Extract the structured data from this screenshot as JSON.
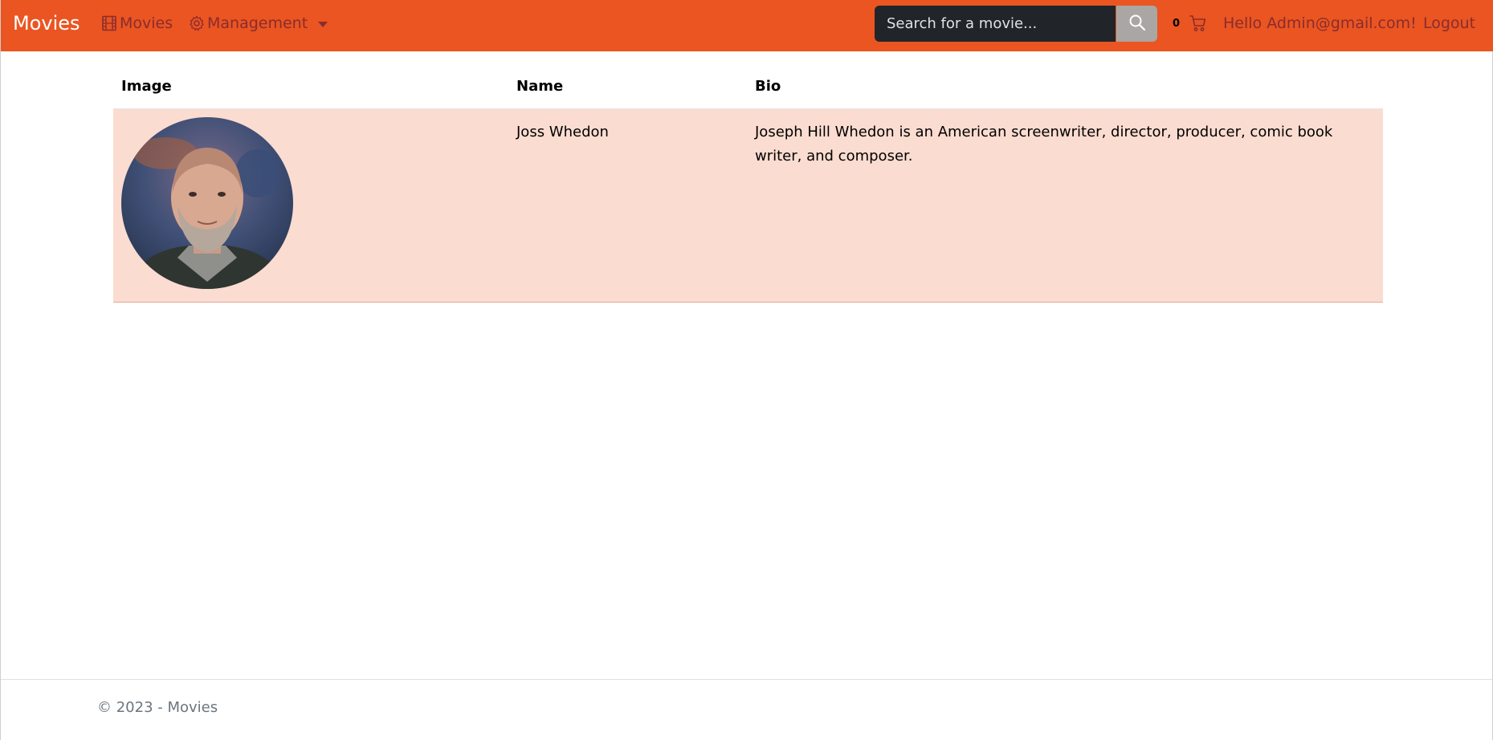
{
  "navbar": {
    "brand": "Movies",
    "movies_link": "Movies",
    "management_link": "Management",
    "search_placeholder": "Search for a movie...",
    "cart_count": "0",
    "greeting": "Hello Admin@gmail.com!",
    "logout": "Logout",
    "background_color": "#ea5522",
    "link_color": "#8a2c2c"
  },
  "table": {
    "headers": [
      "Image",
      "Name",
      "Bio"
    ],
    "rows": [
      {
        "name": "Joss Whedon",
        "bio": "Joseph Hill Whedon is an American screenwriter, director, producer, comic book writer, and composer."
      }
    ],
    "row_color": "#fbdcd1"
  },
  "footer": {
    "text": "© 2023 - Movies"
  }
}
